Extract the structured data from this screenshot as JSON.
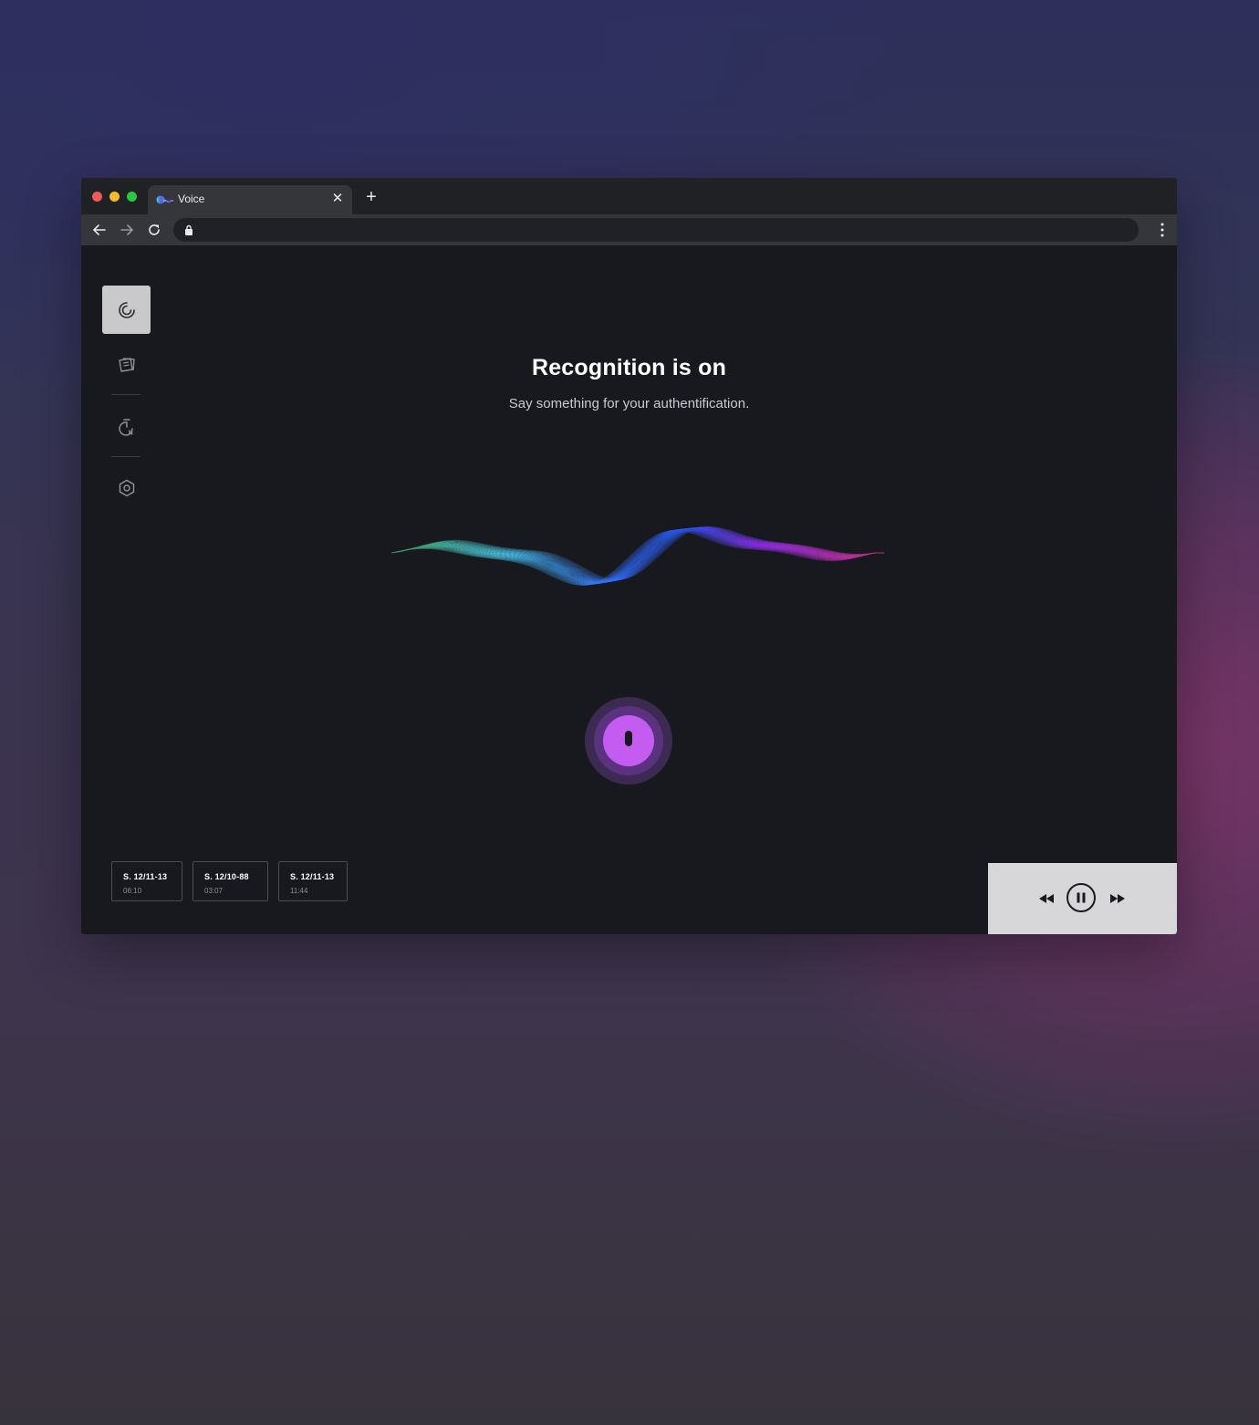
{
  "browser": {
    "tab": {
      "title": "Voice",
      "favicon": "voice-logo-icon"
    },
    "toolbar": {
      "back": "arrow-left-icon",
      "forward": "arrow-right-icon",
      "reload": "reload-icon",
      "url": "",
      "secure": "lock-icon"
    }
  },
  "sidebar": {
    "items": [
      {
        "name": "recognition",
        "icon": "spiral-icon",
        "active": true
      },
      {
        "name": "notes",
        "icon": "note-stack-icon",
        "active": false
      },
      {
        "name": "history",
        "icon": "stopwatch-icon",
        "active": false
      },
      {
        "name": "settings",
        "icon": "hexagon-settings-icon",
        "active": false
      }
    ]
  },
  "main": {
    "title": "Recognition is on",
    "subtitle": "Say something for your authentification.",
    "mic": {
      "icon": "mic-icon",
      "color": "#c45cf2"
    }
  },
  "history": [
    {
      "title": "S. 12/11-13",
      "time": "06:10"
    },
    {
      "title": "S. 12/10-88",
      "time": "03:07"
    },
    {
      "title": "S. 12/11-13",
      "time": "11:44"
    }
  ],
  "player": {
    "rewind": "rewind-icon",
    "pause": "pause-icon",
    "forward": "fast-forward-icon"
  },
  "colors": {
    "wave_start": "#3fa36a",
    "wave_mid1": "#3fb4d8",
    "wave_mid2": "#2e5bf0",
    "wave_mid3": "#8a2be2",
    "wave_end": "#c2307a"
  }
}
